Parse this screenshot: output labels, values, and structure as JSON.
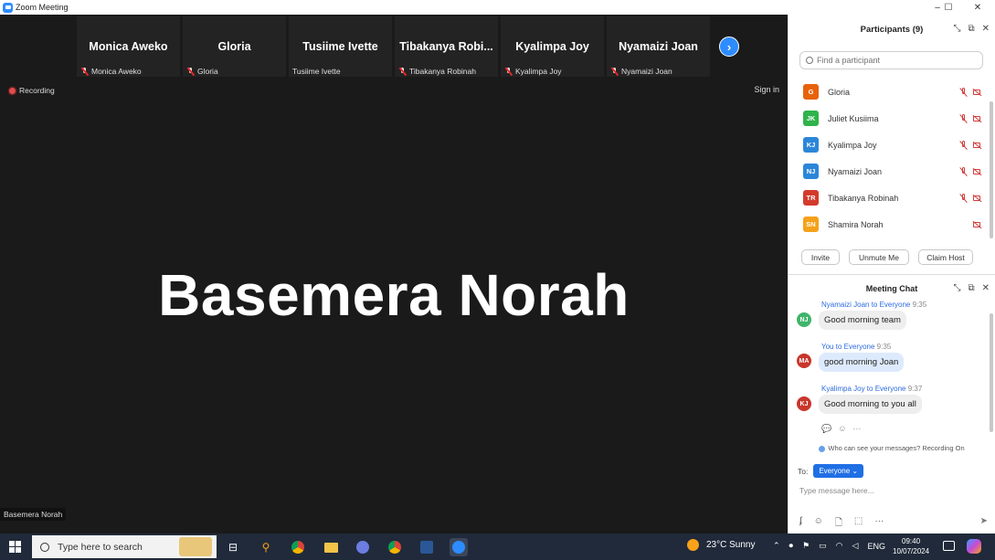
{
  "window": {
    "title": "Zoom Meeting",
    "controls": {
      "minimize": "–",
      "maximize": "☐",
      "close": "✕"
    }
  },
  "gallery": {
    "tiles": [
      {
        "name": "Monica Aweko",
        "caption": "Monica Aweko",
        "muted": true
      },
      {
        "name": "Gloria",
        "caption": "Gloria",
        "muted": true
      },
      {
        "name": "Tusiime Ivette",
        "caption": "Tusiime Ivette",
        "muted": false
      },
      {
        "name": "Tibakanya  Robi...",
        "caption": "Tibakanya Robinah",
        "muted": true
      },
      {
        "name": "Kyalimpa Joy",
        "caption": "Kyalimpa Joy",
        "muted": true
      },
      {
        "name": "Nyamaizi Joan",
        "caption": "Nyamaizi Joan",
        "muted": true
      }
    ],
    "next_icon": "chevron-right-icon"
  },
  "stage": {
    "recording_label": "Recording",
    "signin_label": "Sign in",
    "active_speaker": "Basemera Norah",
    "name_caption": "Basemera Norah"
  },
  "participants": {
    "header": "Participants (9)",
    "search_placeholder": "Find a participant",
    "list": [
      {
        "initials": "G",
        "name": "Gloria",
        "color": "#e8620c",
        "mic_off": true,
        "video_off": true
      },
      {
        "initials": "JK",
        "name": "Juliet Kusiima",
        "color": "#2fb34a",
        "mic_off": true,
        "video_off": true
      },
      {
        "initials": "KJ",
        "name": "Kyalimpa Joy",
        "color": "#2b86d9",
        "mic_off": true,
        "video_off": true
      },
      {
        "initials": "NJ",
        "name": "Nyamaizi Joan",
        "color": "#2b86d9",
        "mic_off": true,
        "video_off": true
      },
      {
        "initials": "TR",
        "name": "Tibakanya Robinah",
        "color": "#d33a2c",
        "mic_off": true,
        "video_off": true
      },
      {
        "initials": "SN",
        "name": "Shamira Norah",
        "color": "#f5a21a",
        "mic_off": false,
        "video_off": true
      }
    ],
    "buttons": {
      "invite": "Invite",
      "unmute_me": "Unmute Me",
      "claim_host": "Claim Host"
    }
  },
  "chat": {
    "header": "Meeting Chat",
    "messages": [
      {
        "initials": "NJ",
        "avatar_color": "#3fb56b",
        "sender": "Nyamaizi Joan to Everyone",
        "time": "9:35",
        "text": "Good morning team",
        "self": false
      },
      {
        "initials": "MA",
        "avatar_color": "#c8362b",
        "sender": "You to Everyone",
        "time": "9:35",
        "text": "good morning Joan",
        "self": true
      },
      {
        "initials": "KJ",
        "avatar_color": "#c8362b",
        "sender": "Kyalimpa Joy to Everyone",
        "time": "9:37",
        "text": "Good morning to you all",
        "self": false
      }
    ],
    "notice": "Who can see your messages? Recording On",
    "to_label": "To:",
    "to_value": "Everyone ⌄",
    "compose_placeholder": "Type message here..."
  },
  "taskbar": {
    "search_placeholder": "Type here to search",
    "weather": "23°C  Sunny",
    "language": "ENG",
    "time": "09:40",
    "date": "10/07/2024"
  },
  "colors": {
    "accent": "#2d8cff",
    "stage_bg": "#1a1a1a",
    "taskbar_bg": "#202a3a",
    "recording": "#e24b4b"
  }
}
